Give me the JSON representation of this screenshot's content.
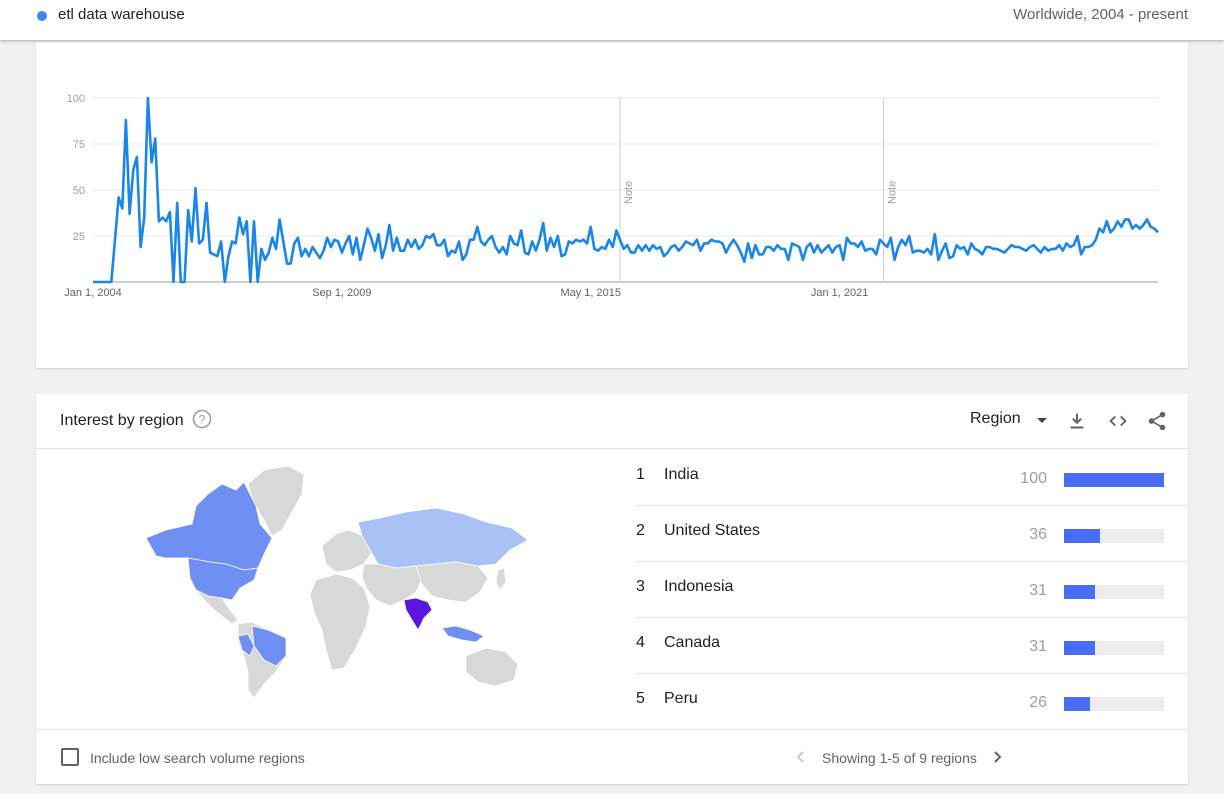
{
  "header": {
    "term_name": "etl data warehouse",
    "term_color": "#4285f4",
    "scope": "Worldwide, 2004 - present"
  },
  "chart_data": {
    "type": "line",
    "title": "",
    "xlabel": "",
    "ylabel": "",
    "ylim": [
      0,
      100
    ],
    "yticks": [
      "100",
      "75",
      "50",
      "25"
    ],
    "xticks": [
      "Jan 1, 2004",
      "Sep 1, 2009",
      "May 1, 2015",
      "Jan 1, 2021"
    ],
    "series_color": "#1a86e8",
    "grid": true,
    "notes": [
      {
        "label": "Note",
        "date": "2016-01"
      },
      {
        "label": "Note",
        "date": "2022-01"
      }
    ],
    "series": [
      {
        "start": "2004-01",
        "frequency": "monthly",
        "values": [
          0,
          0,
          0,
          0,
          0,
          0,
          23,
          46,
          40,
          88,
          37,
          61,
          68,
          19,
          35,
          100,
          65,
          78,
          33,
          35,
          33,
          38,
          0,
          43,
          0,
          0,
          39,
          22,
          51,
          21,
          23,
          43,
          16,
          15,
          14,
          22,
          0,
          14,
          22,
          21,
          35,
          26,
          33,
          0,
          33,
          0,
          18,
          12,
          16,
          24,
          18,
          34,
          22,
          10,
          10,
          21,
          24,
          14,
          18,
          14,
          19,
          16,
          13,
          17,
          24,
          19,
          23,
          22,
          16,
          21,
          25,
          15,
          24,
          12,
          20,
          29,
          24,
          17,
          26,
          13,
          20,
          31,
          17,
          24,
          17,
          17,
          23,
          19,
          23,
          18,
          20,
          25,
          24,
          26,
          20,
          20,
          23,
          14,
          17,
          16,
          22,
          12,
          15,
          23,
          23,
          30,
          22,
          20,
          23,
          25,
          19,
          16,
          19,
          15,
          25,
          21,
          20,
          28,
          16,
          15,
          22,
          17,
          23,
          32,
          17,
          24,
          19,
          25,
          14,
          15,
          22,
          21,
          23,
          22,
          23,
          21,
          30,
          18,
          17,
          19,
          18,
          23,
          19,
          28,
          23,
          18,
          20,
          16,
          16,
          20,
          17,
          20,
          17,
          20,
          18,
          19,
          14,
          16,
          19,
          20,
          17,
          19,
          22,
          21,
          20,
          23,
          17,
          21,
          21,
          23,
          22,
          22,
          21,
          16,
          20,
          23,
          20,
          16,
          11,
          21,
          13,
          20,
          15,
          15,
          19,
          19,
          17,
          20,
          18,
          18,
          12,
          21,
          20,
          19,
          12,
          19,
          21,
          16,
          20,
          16,
          18,
          20,
          16,
          19,
          20,
          12,
          24,
          21,
          21,
          19,
          22,
          17,
          18,
          18,
          15,
          23,
          21,
          19,
          24,
          12,
          19,
          23,
          20,
          25,
          16,
          17,
          17,
          16,
          18,
          15,
          26,
          12,
          17,
          21,
          13,
          14,
          20,
          18,
          19,
          15,
          21,
          18,
          17,
          15,
          19,
          19,
          18,
          18,
          17,
          16,
          18,
          20,
          19,
          19,
          18,
          17,
          19,
          20,
          18,
          16,
          19,
          17,
          18,
          18,
          20,
          17,
          21,
          19,
          20,
          25,
          15,
          19,
          19,
          20,
          23,
          29,
          27,
          33,
          27,
          29,
          33,
          30,
          34,
          34,
          29,
          31,
          29,
          31,
          34,
          30,
          29,
          27
        ]
      }
    ]
  },
  "region": {
    "title": "Interest by region",
    "select_label": "Region",
    "rows": [
      {
        "rank": "1",
        "name": "India",
        "value": "100",
        "fraction": 1.0
      },
      {
        "rank": "2",
        "name": "United States",
        "value": "36",
        "fraction": 0.36
      },
      {
        "rank": "3",
        "name": "Indonesia",
        "value": "31",
        "fraction": 0.31
      },
      {
        "rank": "4",
        "name": "Canada",
        "value": "31",
        "fraction": 0.31
      },
      {
        "rank": "5",
        "name": "Peru",
        "value": "26",
        "fraction": 0.26
      }
    ],
    "bar_color": "#4a6cf7",
    "map_colors": {
      "max": "#5a16e0",
      "mid": "#6f8ff2",
      "low": "#a9c1f4",
      "none": "#d8d8d8"
    }
  },
  "footer": {
    "checkbox_label": "Include low search volume regions",
    "page_info": "Showing 1-5 of 9 regions"
  }
}
